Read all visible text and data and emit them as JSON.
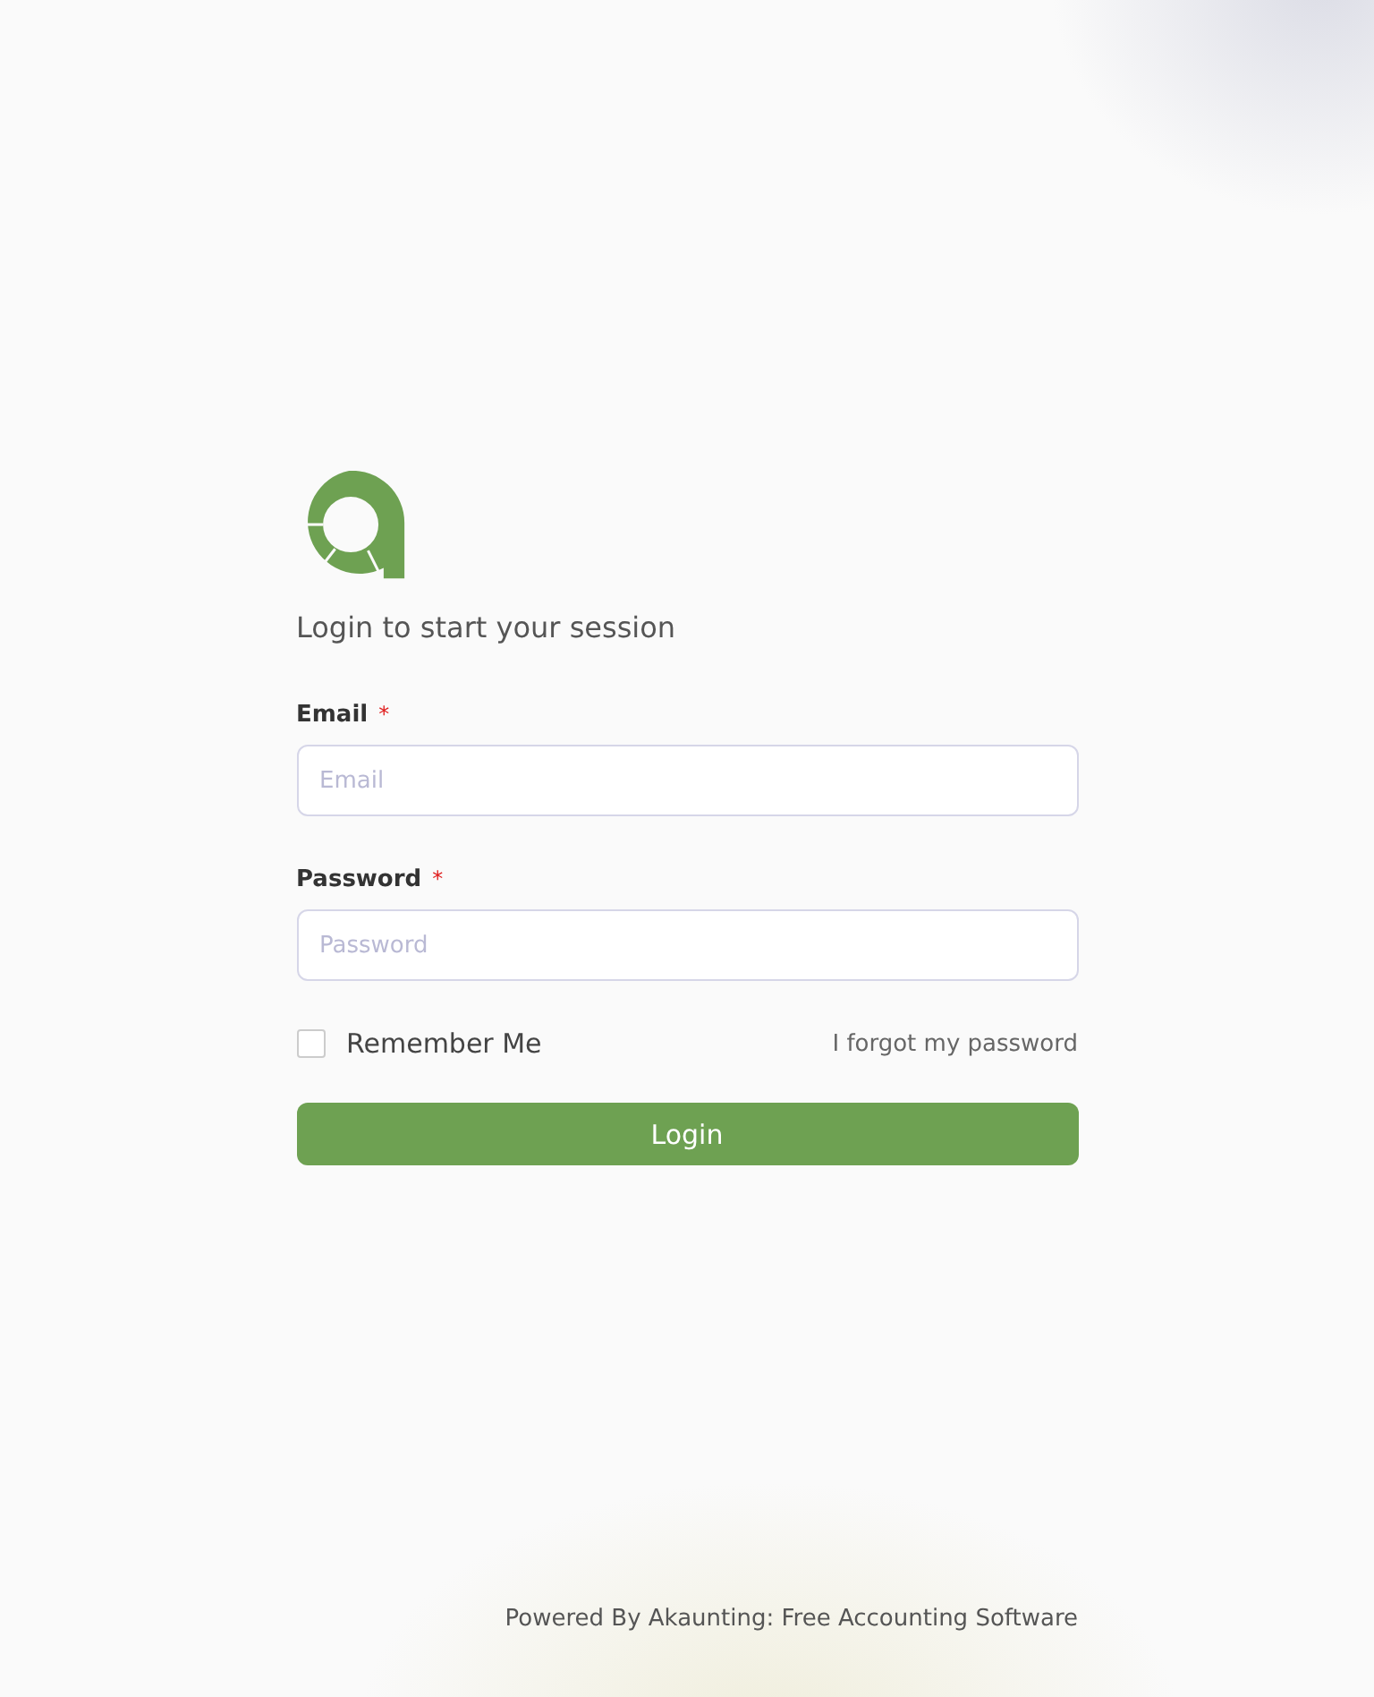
{
  "subtitle": "Login to start your session",
  "fields": [
    {
      "label": "Email",
      "required_mark": "*",
      "placeholder": "Email"
    },
    {
      "label": "Password",
      "required_mark": "*",
      "placeholder": "Password"
    }
  ],
  "remember": {
    "label": "Remember Me",
    "checked": false
  },
  "forgot_link": "I forgot my password",
  "login_button": "Login",
  "footer": "Powered By Akaunting: Free Accounting Software"
}
